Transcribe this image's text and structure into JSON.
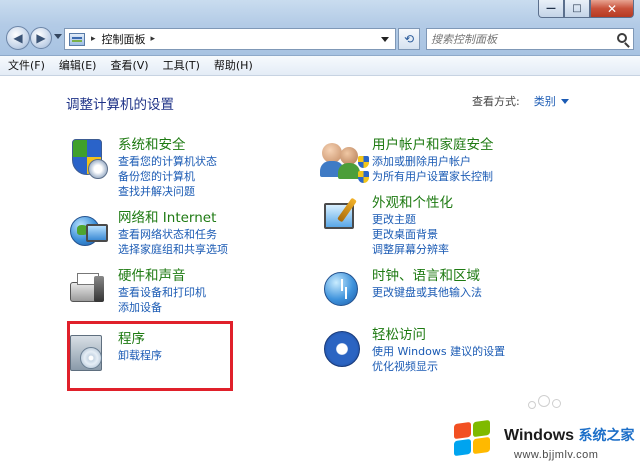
{
  "window": {
    "minimize_glyph": "—",
    "maximize_glyph": "□",
    "close_glyph": "✕"
  },
  "nav": {
    "back_glyph": "◀",
    "forward_glyph": "▶",
    "address_separator": "▸",
    "address_path": "控制面板",
    "address_separator2": "▸",
    "refresh_glyph": "⟲",
    "search_placeholder": "搜索控制面板"
  },
  "menubar": {
    "items": [
      "文件(F)",
      "编辑(E)",
      "查看(V)",
      "工具(T)",
      "帮助(H)"
    ]
  },
  "main": {
    "title": "调整计算机的设置",
    "view_by_label": "查看方式:",
    "view_by_value": "类别"
  },
  "categories": {
    "system": {
      "title": "系统和安全",
      "links": [
        "查看您的计算机状态",
        "备份您的计算机",
        "查找并解决问题"
      ]
    },
    "network": {
      "title": "网络和 Internet",
      "links": [
        "查看网络状态和任务",
        "选择家庭组和共享选项"
      ]
    },
    "hardware": {
      "title": "硬件和声音",
      "links": [
        "查看设备和打印机",
        "添加设备"
      ]
    },
    "programs": {
      "title": "程序",
      "links": [
        "卸载程序"
      ]
    },
    "users": {
      "title": "用户帐户和家庭安全",
      "links": [
        "添加或删除用户帐户",
        "为所有用户设置家长控制"
      ]
    },
    "appearance": {
      "title": "外观和个性化",
      "links": [
        "更改主题",
        "更改桌面背景",
        "调整屏幕分辨率"
      ]
    },
    "clock": {
      "title": "时钟、语言和区域",
      "links": [
        "更改键盘或其他输入法"
      ]
    },
    "ease": {
      "title": "轻松访问",
      "links": [
        "使用 Windows 建议的设置",
        "优化视频显示"
      ]
    }
  },
  "watermark": {
    "brand": "Windows",
    "brand_cn": "系统之家",
    "url": "www.bjjmlv.com"
  },
  "colors": {
    "category_title": "#1e7a12",
    "link": "#1b5bb4",
    "heading": "#1e3287",
    "highlight_box": "#e0202a"
  }
}
